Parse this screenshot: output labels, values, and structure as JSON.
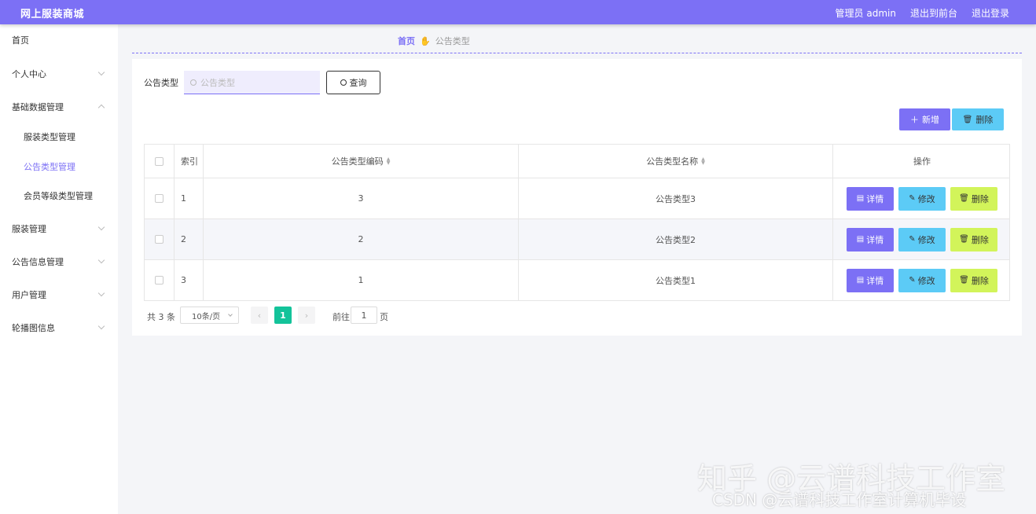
{
  "header": {
    "app_title": "网上服装商城",
    "admin_label": "管理员 admin",
    "exit_front": "退出到前台",
    "logout": "退出登录"
  },
  "sidebar": {
    "items": [
      {
        "label": "首页"
      },
      {
        "label": "个人中心"
      },
      {
        "label": "基础数据管理"
      },
      {
        "label": "服装类型管理"
      },
      {
        "label": "公告类型管理"
      },
      {
        "label": "会员等级类型管理"
      },
      {
        "label": "服装管理"
      },
      {
        "label": "公告信息管理"
      },
      {
        "label": "用户管理"
      },
      {
        "label": "轮播图信息"
      }
    ]
  },
  "breadcrumb": {
    "home": "首页",
    "current": "公告类型"
  },
  "search": {
    "label": "公告类型",
    "placeholder": "公告类型",
    "query_button": "查询"
  },
  "actions": {
    "add": "新增",
    "delete": "删除"
  },
  "table": {
    "headers": {
      "index": "索引",
      "code": "公告类型编码",
      "name": "公告类型名称",
      "ops": "操作"
    },
    "rows": [
      {
        "index": "1",
        "code": "3",
        "name": "公告类型3"
      },
      {
        "index": "2",
        "code": "2",
        "name": "公告类型2"
      },
      {
        "index": "3",
        "code": "1",
        "name": "公告类型1"
      }
    ],
    "row_buttons": {
      "detail": "详情",
      "edit": "修改",
      "delete": "删除"
    }
  },
  "pagination": {
    "total": "共 3 条",
    "page_size": "10条/页",
    "current_page": "1",
    "goto_prefix": "前往",
    "goto_value": "1",
    "goto_suffix": "页"
  },
  "watermarks": {
    "line1": "知乎 @云谱科技工作室",
    "line2": "CSDN @云谱科技工作室计算机毕设"
  },
  "colors": {
    "primary": "#7c70f5",
    "info": "#5ccbf6",
    "lime": "#d2f45a",
    "pager_active": "#13c39a"
  }
}
